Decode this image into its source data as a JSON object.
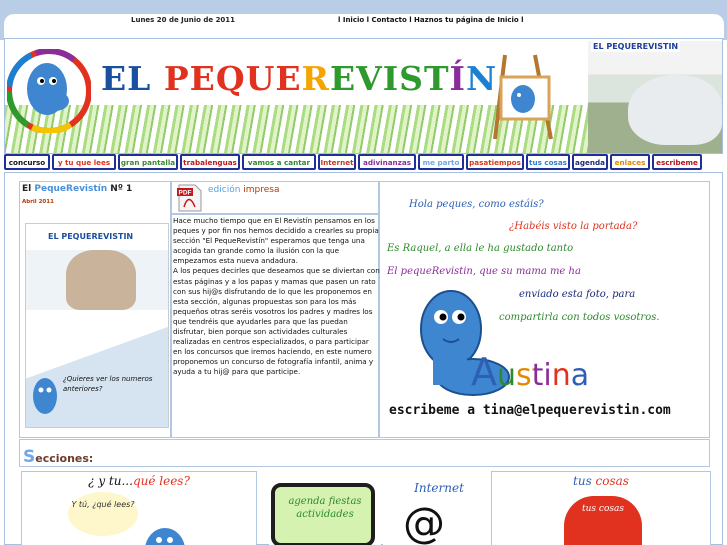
{
  "header": {
    "date": "Lunes 20 de Junio de 2011",
    "links": [
      "l Inicio l",
      "Contacto",
      "l Haznos tu página de Inicio l"
    ]
  },
  "banner": {
    "title": [
      "EL ",
      "PEQUE",
      "R",
      "EVIST",
      "Í",
      "N"
    ],
    "photo_badge": "EL PEQUEREVISTIN"
  },
  "nav": [
    {
      "label": "concurso",
      "color": "#111111"
    },
    {
      "label": "y tu que lees",
      "color": "#e0321f"
    },
    {
      "label": "gran pantalla",
      "color": "#3a8a2e"
    },
    {
      "label": "trabalenguas",
      "color": "#b41c1c"
    },
    {
      "label": "vamos a cantar",
      "color": "#2e8a2e"
    },
    {
      "label": "Internet",
      "color": "#c03a20"
    },
    {
      "label": "adivinanzas",
      "color": "#8a2d9a"
    },
    {
      "label": "me parto",
      "color": "#6ea8e6"
    },
    {
      "label": "pasatiempos",
      "color": "#d43a1a"
    },
    {
      "label": "tus cosas",
      "color": "#2d7fd0"
    },
    {
      "label": "agenda",
      "color": "#1b2a7a"
    },
    {
      "label": "enlaces",
      "color": "#e08a00"
    },
    {
      "label": "escribeme",
      "color": "#b5131a"
    }
  ],
  "issue": {
    "title_prefix": "El ",
    "title_brand": "PequeRevistín",
    "title_suffix": " Nº 1",
    "date": "Abril 2011",
    "cover_head": "EL PEQUEREVISTIN",
    "cover_question": "¿Quieres ver los numeros anteriores?"
  },
  "pdf": {
    "label_a": "edición",
    "label_b": " impresa"
  },
  "article": {
    "p1": "Hace mucho tiempo que en El Revistín pensamos en los peques y por fin nos hemos decidido a crearles su propia sección \"El PequeRevistín\" esperamos que tenga una acogida tan grande como la ilusión con la que empezamos esta nueva andadura.",
    "p2": "A los peques decirles que deseamos que se diviertan con estas páginas y a los papas y mamas que pasen un rato con sus hij@s disfrutando de lo que les proponemos en esta sección, algunas propuestas son para los más pequeños otras seréis vosotros los padres y madres los que tendréis que ayudarles para que las puedan disfrutar, bien porque son actividades culturales realizadas en centros especializados, o para participar en los concursos que iremos haciendo, en este numero proponemos un concurso de fotografía infantil, anima y ayuda a tu hij@ para que participe."
  },
  "tina": {
    "lines": [
      "Hola peques, como estáis?",
      "¿Habéis visto la portada?",
      "Es Raquel, a ella le ha gustado tanto",
      "El pequeRevistin, que su mama me ha",
      "enviado esta foto, para",
      "compartirla con todos vosotros."
    ],
    "name_a": "A",
    "name_rest": "ustina",
    "email": "escribeme a tina@elpequerevistin.com"
  },
  "sections": {
    "heading_s": "S",
    "heading_rest": "ecciones:",
    "cards": [
      {
        "title_a": "¿ y tu...",
        "title_b": "qué lees?",
        "bubble": "Y tú, ¿qué lees?"
      },
      {
        "title": "agenda fiestas actividades"
      },
      {
        "title": "Internet"
      },
      {
        "title_a": "tus ",
        "title_b": "cosas",
        "sub": "tus cosas"
      }
    ]
  }
}
